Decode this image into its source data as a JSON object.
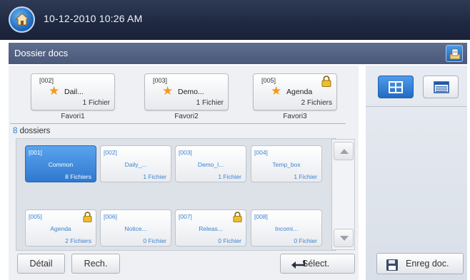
{
  "status": {
    "datetime": "10-12-2010 10:26 AM"
  },
  "titlebar": {
    "title": "Dossier docs"
  },
  "favorites": [
    {
      "code": "[002]",
      "name": "Dail...",
      "count": "1 Fichier",
      "label": "Favori1",
      "locked": false
    },
    {
      "code": "[003]",
      "name": "Demo...",
      "count": "1 Fichier",
      "label": "Favori2",
      "locked": false
    },
    {
      "code": "[005]",
      "name": "Agenda",
      "count": "2 Fichiers",
      "label": "Favori3",
      "locked": true
    }
  ],
  "folder_summary": {
    "count": "8",
    "label": " dossiers"
  },
  "folders": [
    {
      "code": "[001]",
      "name": "Common",
      "count": "8 Fichiers",
      "selected": true,
      "locked": false
    },
    {
      "code": "[002]",
      "name": "Daily_...",
      "count": "1 Fichier",
      "selected": false,
      "locked": false
    },
    {
      "code": "[003]",
      "name": "Demo_l...",
      "count": "1 Fichier",
      "selected": false,
      "locked": false
    },
    {
      "code": "[004]",
      "name": "Temp_box",
      "count": "1 Fichier",
      "selected": false,
      "locked": false
    },
    {
      "code": "[005]",
      "name": "Agenda",
      "count": "2 Fichiers",
      "selected": false,
      "locked": true
    },
    {
      "code": "[006]",
      "name": "Notice...",
      "count": "0 Fichier",
      "selected": false,
      "locked": false
    },
    {
      "code": "[007]",
      "name": "Releas...",
      "count": "0 Fichier",
      "selected": false,
      "locked": true
    },
    {
      "code": "[008]",
      "name": "Incomi...",
      "count": "0 Fichier",
      "selected": false,
      "locked": false
    }
  ],
  "buttons": {
    "detail": "Détail",
    "search": "Rech.",
    "select": "Sélect.",
    "save": "Enreg doc."
  },
  "icons": {
    "home": "home-icon",
    "titlebar": "document-tray-icon",
    "favorite": "star-icon",
    "lock": "lock-icon",
    "grid_view": "grid-view-icon",
    "list_view": "list-view-icon",
    "enter": "enter-arrow-icon",
    "save": "floppy-disk-icon"
  },
  "colors": {
    "accent": "#2f7fd6",
    "selected": "#2f78cf",
    "star": "#f29a1b",
    "lock": "#e0a400"
  }
}
